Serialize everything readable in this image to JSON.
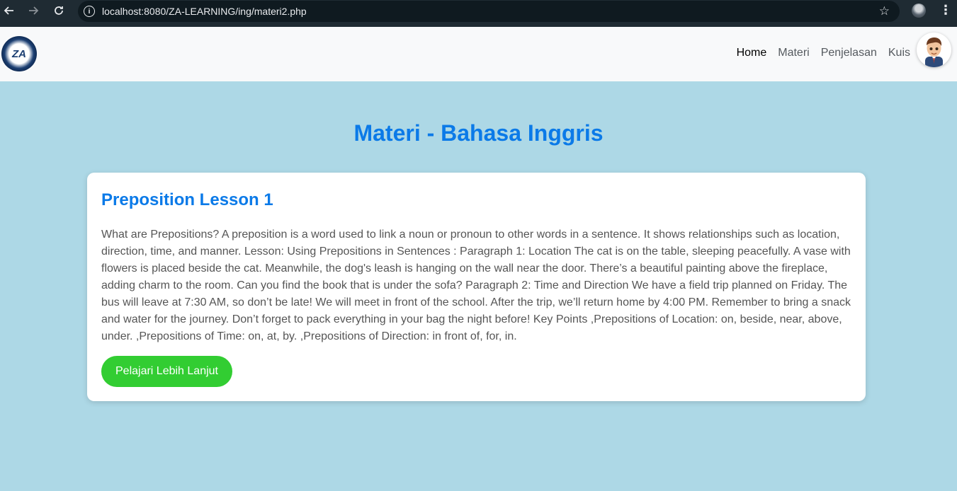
{
  "browser": {
    "url": "localhost:8080/ZA-LEARNING/ing/materi2.php"
  },
  "navbar": {
    "logo_text": "ZA",
    "links": [
      {
        "label": "Home"
      },
      {
        "label": "Materi"
      },
      {
        "label": "Penjelasan"
      },
      {
        "label": "Kuis"
      }
    ]
  },
  "main": {
    "page_title": "Materi - Bahasa Inggris",
    "lesson": {
      "title": "Preposition Lesson 1",
      "text": "What are Prepositions? A preposition is a word used to link a noun or pronoun to other words in a sentence. It shows relationships such as location, direction, time, and manner. Lesson: Using Prepositions in Sentences : Paragraph 1: Location The cat is on the table, sleeping peacefully. A vase with flowers is placed beside the cat. Meanwhile, the dog's leash is hanging on the wall near the door. There’s a beautiful painting above the fireplace, adding charm to the room. Can you find the book that is under the sofa? Paragraph 2: Time and Direction We have a field trip planned on Friday. The bus will leave at 7:30 AM, so don’t be late! We will meet in front of the school. After the trip, we’ll return home by 4:00 PM. Remember to bring a snack and water for the journey. Don’t forget to pack everything in your bag the night before! Key Points ,Prepositions of Location: on, beside, near, above, under. ,Prepositions of Time: on, at, by. ,Prepositions of Direction: in front of, for, in.",
      "button_label": "Pelajari Lebih Lanjut"
    }
  },
  "colors": {
    "page_background": "#add8e6",
    "accent_blue": "#0b7ae8",
    "button_green": "#32cd32"
  }
}
